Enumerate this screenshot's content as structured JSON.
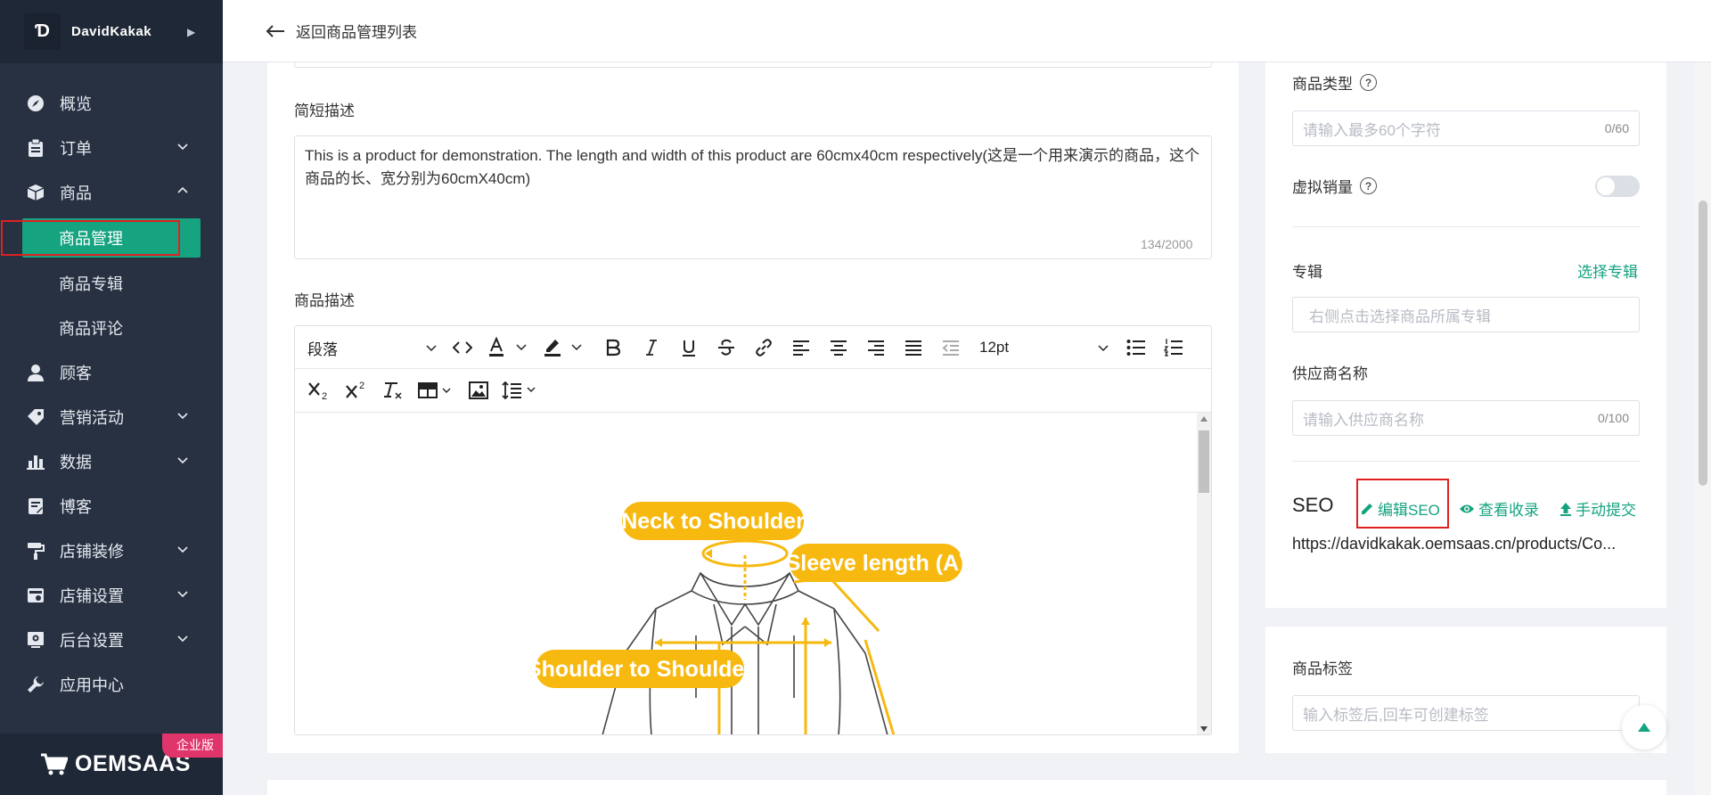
{
  "sidebar": {
    "brand_initial": "Ɗ",
    "brand_name": "DavidKakak",
    "menu": [
      {
        "label": "概览",
        "icon": "dashboard-icon",
        "has_chevron": false
      },
      {
        "label": "订单",
        "icon": "clipboard-icon",
        "has_chevron": true,
        "chevron": "down"
      },
      {
        "label": "商品",
        "icon": "box-icon",
        "has_chevron": true,
        "chevron": "up"
      },
      {
        "label": "顾客",
        "icon": "user-icon",
        "has_chevron": false
      },
      {
        "label": "营销活动",
        "icon": "tag-icon",
        "has_chevron": true,
        "chevron": "down"
      },
      {
        "label": "数据",
        "icon": "bar-chart-icon",
        "has_chevron": true,
        "chevron": "down"
      },
      {
        "label": "博客",
        "icon": "blog-icon",
        "has_chevron": false
      },
      {
        "label": "店铺装修",
        "icon": "paint-roller-icon",
        "has_chevron": true,
        "chevron": "down"
      },
      {
        "label": "店铺设置",
        "icon": "store-settings-icon",
        "has_chevron": true,
        "chevron": "down"
      },
      {
        "label": "后台设置",
        "icon": "gear-icon",
        "has_chevron": true,
        "chevron": "down"
      },
      {
        "label": "应用中心",
        "icon": "wrench-icon",
        "has_chevron": false
      }
    ],
    "submenu": [
      {
        "label": "商品管理",
        "active": true
      },
      {
        "label": "商品专辑",
        "active": false
      },
      {
        "label": "商品评论",
        "active": false
      }
    ],
    "footer_logo": "OEMSAAS",
    "footer_badge": "企业版"
  },
  "topbar": {
    "back_label": "返回商品管理列表"
  },
  "main": {
    "short_desc_label": "简短描述",
    "short_desc_value": "This is a product for demonstration. The length and width of this product are 60cmx40cm respectively(这是一个用来演示的商品，这个商品的长、宽分别为60cmX40cm)",
    "short_desc_count": "134/2000",
    "desc_label": "商品描述",
    "toolbar": {
      "block_format": "段落",
      "font_size": "12pt"
    },
    "size_chart": {
      "labels": [
        "Neck to Shoulder",
        "Sleeve length (A)",
        "Shoulder to Shoulder"
      ]
    }
  },
  "right": {
    "product_type_label": "商品类型",
    "product_type_placeholder": "请输入最多60个字符",
    "product_type_count": "0/60",
    "virtual_sales_label": "虚拟销量",
    "virtual_sales_enabled": false,
    "album_label": "专辑",
    "album_link": "选择专辑",
    "album_placeholder": "右侧点击选择商品所属专辑",
    "supplier_label": "供应商名称",
    "supplier_placeholder": "请输入供应商名称",
    "supplier_count": "0/100",
    "seo_title": "SEO",
    "seo_edit": "编辑SEO",
    "seo_view": "查看收录",
    "seo_submit": "手动提交",
    "seo_url": "https://davidkakak.oemsaas.cn/products/Co...",
    "tags_label": "商品标签",
    "tags_placeholder": "输入标签后,回车可创建标签"
  },
  "colors": {
    "sidebar_bg": "#273142",
    "accent_green": "#15a380",
    "highlight_red": "#e02020",
    "badge_pink": "#e0356b",
    "size_chart_yellow": "#f7b90f"
  }
}
